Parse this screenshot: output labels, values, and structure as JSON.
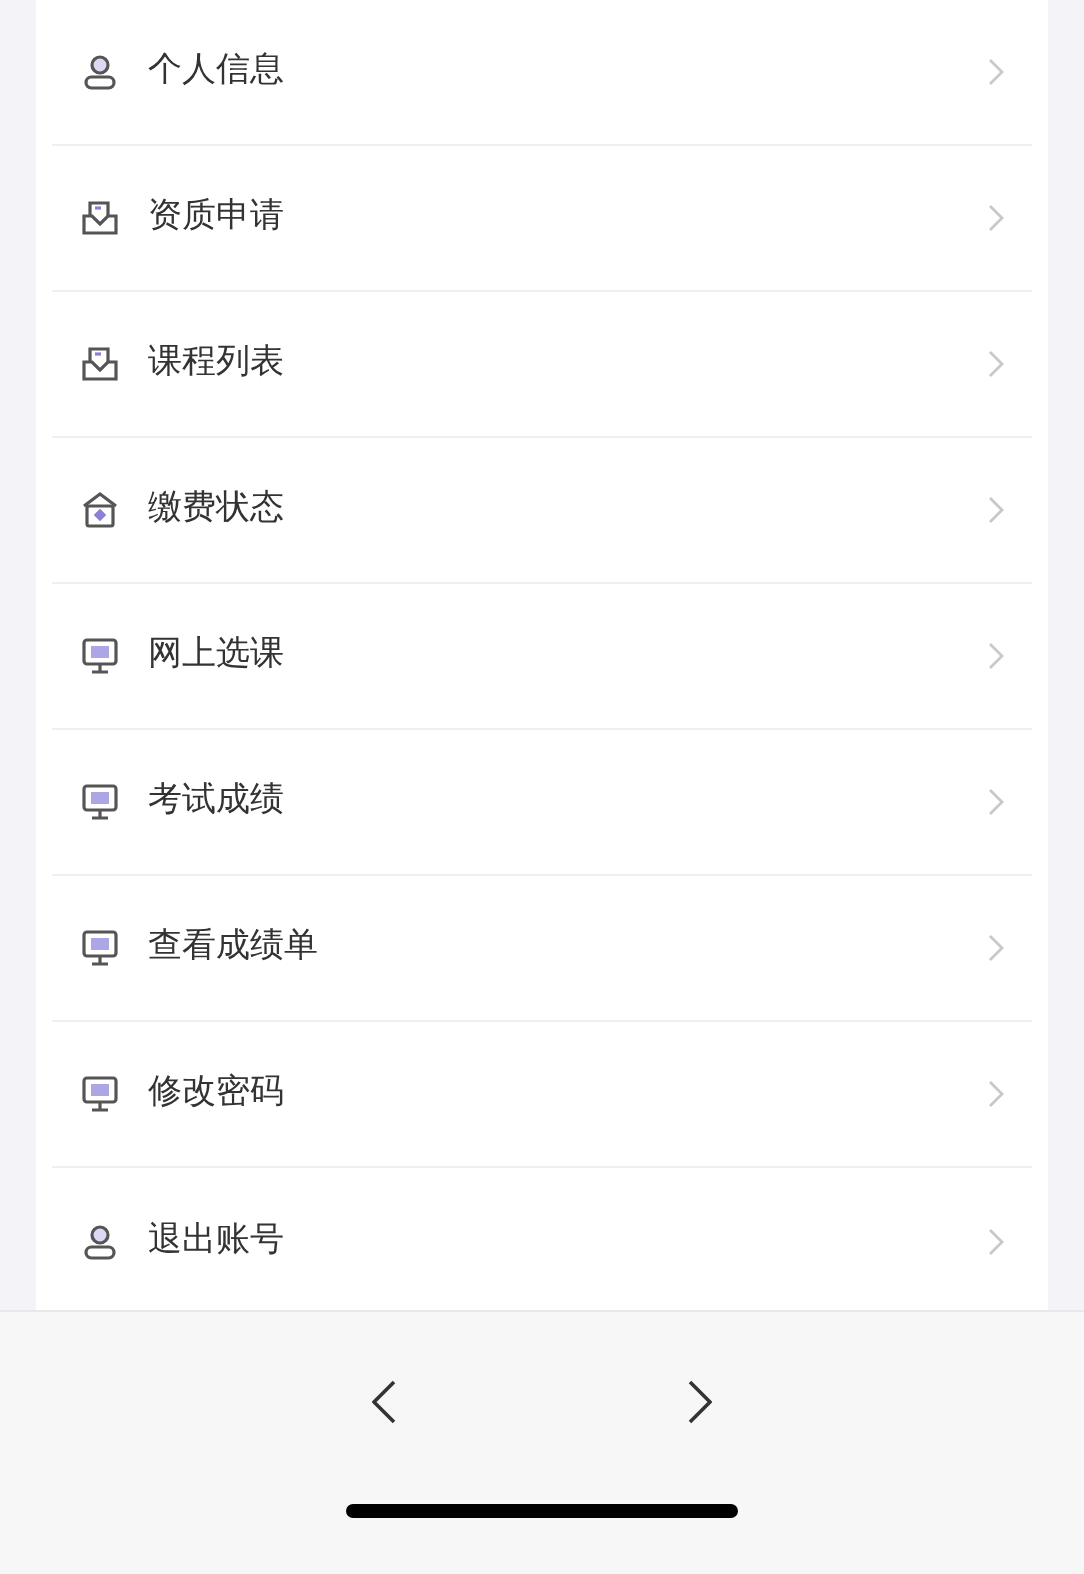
{
  "menu": [
    {
      "label": "个人信息",
      "kind": "person"
    },
    {
      "label": "资质申请",
      "kind": "tray"
    },
    {
      "label": "课程列表",
      "kind": "tray"
    },
    {
      "label": "缴费状态",
      "kind": "house"
    },
    {
      "label": "网上选课",
      "kind": "monitor"
    },
    {
      "label": "考试成绩",
      "kind": "monitor"
    },
    {
      "label": "查看成绩单",
      "kind": "monitor"
    },
    {
      "label": "修改密码",
      "kind": "monitor"
    },
    {
      "label": "退出账号",
      "kind": "person"
    }
  ]
}
